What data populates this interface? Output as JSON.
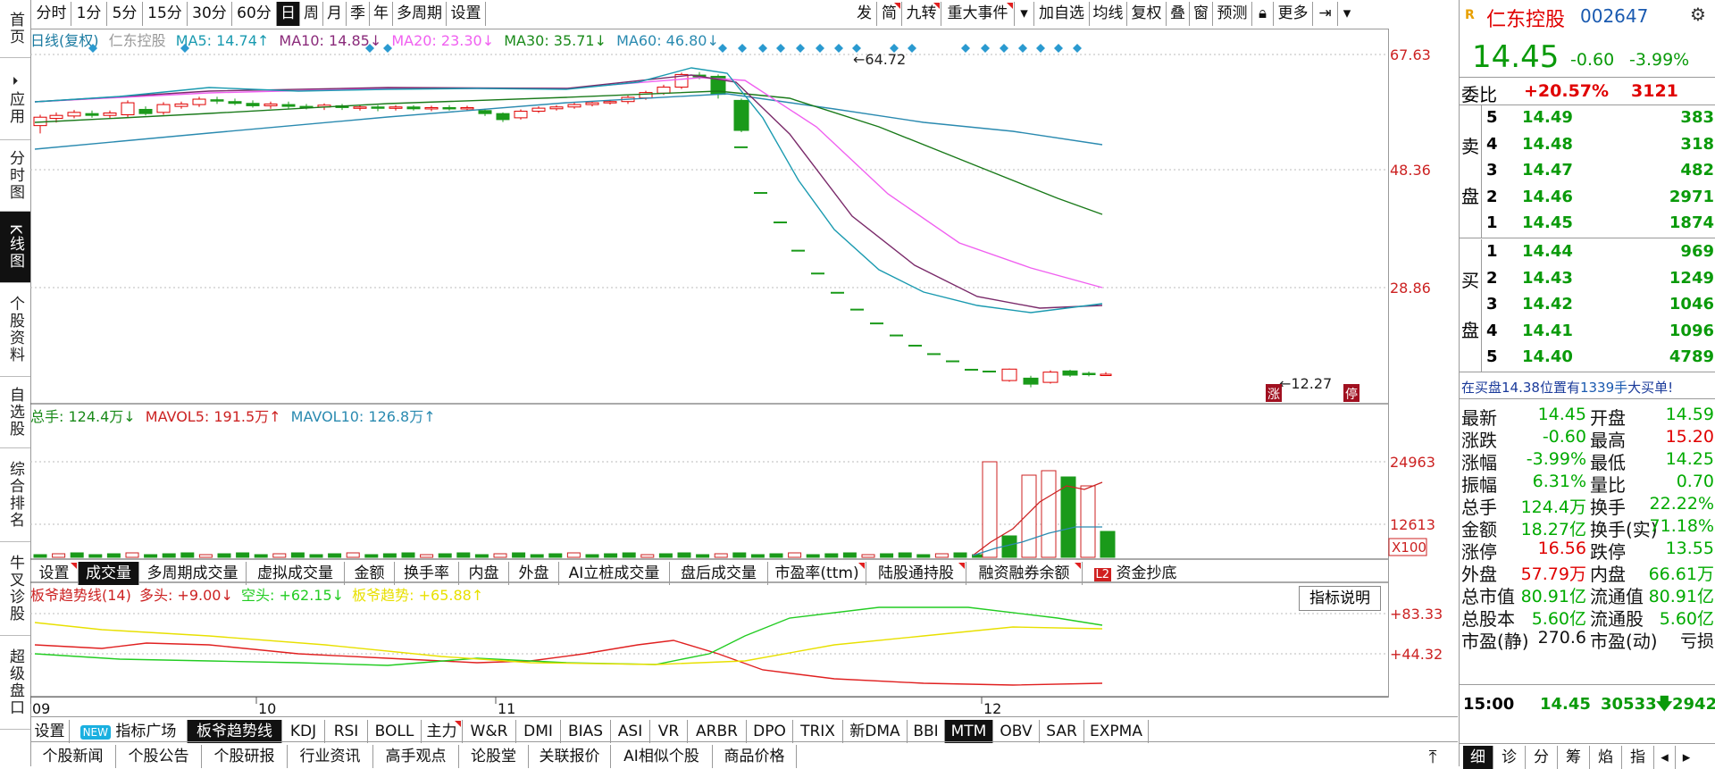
{
  "left_nav": [
    "首页",
    "应用",
    "分时图",
    "K线图",
    "个股资料",
    "自选股",
    "综合排名",
    "牛叉诊股",
    "超级盘口"
  ],
  "period_tabs": [
    "分时",
    "1分",
    "5分",
    "15分",
    "30分",
    "60分",
    "日",
    "周",
    "月",
    "季",
    "年",
    "多周期",
    "设置"
  ],
  "tool_tabs": [
    "发",
    "简",
    "九转",
    "重大事件",
    "加自选",
    "均线",
    "复权",
    "叠",
    "窗",
    "预测",
    "更多"
  ],
  "ma_legend": {
    "title": "日线(复权)",
    "stock": "仁东控股",
    "ma5": "MA5: 14.74↑",
    "ma10": "MA10: 14.85↓",
    "ma20": "MA20: 23.30↓",
    "ma30": "MA30: 35.71↓",
    "ma60": "MA60: 46.80↓"
  },
  "price_axis": [
    "67.63",
    "48.36",
    "28.86"
  ],
  "price_marks": {
    "high": "64.72",
    "low": "12.27",
    "tag_zhang": "涨",
    "tag_ting": "停"
  },
  "vol_legend": {
    "total": "总手: 124.4万↓",
    "mavol5": "MAVOL5: 191.5万↑",
    "mavol10": "MAVOL10: 126.8万↑"
  },
  "vol_axis": [
    "24963",
    "12613",
    "X100"
  ],
  "sub_tabs": [
    "设置",
    "成交量",
    "多周期成交量",
    "虚拟成交量",
    "金额",
    "换手率",
    "内盘",
    "外盘",
    "AI立桩成交量",
    "盘后成交量",
    "市盈率(ttm)",
    "陆股通持股",
    "融资融券余额",
    "资金抄底"
  ],
  "sub_tab_l2": "L2",
  "ind_legend": {
    "title": "板爷趋势线(14)",
    "duo": "多头: +9.00↓",
    "kong": "空头: +62.15↓",
    "trend": "板爷趋势: +65.88↑"
  },
  "ind_button": "指标说明",
  "ind_axis": [
    "+83.33",
    "+44.32"
  ],
  "date_axis": [
    "09",
    "10",
    "11",
    "12"
  ],
  "indicator_tabs": [
    "设置",
    "指标广场",
    "板爷趋势线",
    "KDJ",
    "RSI",
    "BOLL",
    "主力",
    "W&R",
    "DMI",
    "BIAS",
    "ASI",
    "VR",
    "ARBR",
    "DPO",
    "TRIX",
    "新DMA",
    "BBI",
    "MTM",
    "OBV",
    "SAR",
    "EXPMA"
  ],
  "new_badge": "NEW",
  "news_tabs": [
    "个股新闻",
    "个股公告",
    "个股研报",
    "行业资讯",
    "高手观点",
    "论股堂",
    "关联报价",
    "AI相似个股",
    "商品价格"
  ],
  "quote": {
    "r_tag": "R",
    "name": "仁东控股",
    "code": "002647",
    "price": "14.45",
    "change": "-0.60",
    "pct": "-3.99%",
    "weibi_label": "委比",
    "weibi": "+20.57%",
    "weicha": "3121",
    "sell_label": [
      "卖",
      "盘"
    ],
    "buy_label": [
      "买",
      "盘"
    ],
    "sell": [
      {
        "lvl": "5",
        "price": "14.49",
        "vol": "383"
      },
      {
        "lvl": "4",
        "price": "14.48",
        "vol": "318"
      },
      {
        "lvl": "3",
        "price": "14.47",
        "vol": "482"
      },
      {
        "lvl": "2",
        "price": "14.46",
        "vol": "2971"
      },
      {
        "lvl": "1",
        "price": "14.45",
        "vol": "1874"
      }
    ],
    "buy": [
      {
        "lvl": "1",
        "price": "14.44",
        "vol": "969"
      },
      {
        "lvl": "2",
        "price": "14.43",
        "vol": "1249"
      },
      {
        "lvl": "3",
        "price": "14.42",
        "vol": "1046"
      },
      {
        "lvl": "4",
        "price": "14.41",
        "vol": "1096"
      },
      {
        "lvl": "5",
        "price": "14.40",
        "vol": "4789"
      }
    ],
    "notice": "在买盘14.38位置有",
    "notice_vol": "1339手",
    "notice_tail": "大买单!",
    "stats": [
      {
        "l1": "最新",
        "v1": "14.45",
        "c1": "#00aa00",
        "l2": "开盘",
        "v2": "14.59",
        "c2": "#00aa00"
      },
      {
        "l1": "涨跌",
        "v1": "-0.60",
        "c1": "#00aa00",
        "l2": "最高",
        "v2": "15.20",
        "c2": "#e00000"
      },
      {
        "l1": "涨幅",
        "v1": "-3.99%",
        "c1": "#00aa00",
        "l2": "最低",
        "v2": "14.25",
        "c2": "#00aa00"
      },
      {
        "l1": "振幅",
        "v1": "6.31%",
        "c1": "#00aa00",
        "l2": "量比",
        "v2": "0.70",
        "c2": "#00aa00"
      },
      {
        "l1": "总手",
        "v1": "124.4万",
        "c1": "#00aa00",
        "l2": "换手",
        "v2": "22.22%",
        "c2": "#00aa00"
      },
      {
        "l1": "金额",
        "v1": "18.27亿",
        "c1": "#00aa00",
        "l2": "换手(实)",
        "v2": "71.18%",
        "c2": "#00aa00"
      },
      {
        "l1": "涨停",
        "v1": "16.56",
        "c1": "#e00000",
        "l2": "跌停",
        "v2": "13.55",
        "c2": "#00aa00"
      },
      {
        "l1": "外盘",
        "v1": "57.79万",
        "c1": "#e00000",
        "l2": "内盘",
        "v2": "66.61万",
        "c2": "#00aa00"
      },
      {
        "l1": "总市值",
        "v1": "80.91亿",
        "c1": "#00aa00",
        "l2": "流通值",
        "v2": "80.91亿",
        "c2": "#00aa00"
      },
      {
        "l1": "总股本",
        "v1": "5.60亿",
        "c1": "#00aa00",
        "l2": "流通股",
        "v2": "5.60亿",
        "c2": "#00aa00"
      },
      {
        "l1": "市盈(静)",
        "v1": "270.6",
        "c1": "#111111",
        "l2": "市盈(动)",
        "v2": "亏损",
        "c2": "#111111"
      }
    ],
    "tick_time": "15:00",
    "tick_price": "14.45",
    "tick_vol": "30533",
    "tick_vol2": "2942",
    "bottom_tabs": [
      "细",
      "诊",
      "分",
      "筹",
      "焰",
      "指"
    ]
  },
  "colors": {
    "up": "#e00000",
    "down": "#1a9a1a",
    "ma5": "#111111",
    "ma10": "#7a2a6a",
    "ma20": "#f060f0",
    "ma30": "#1a7a1a",
    "ma60": "#2a8ab0",
    "axis": "#cc2222"
  }
}
